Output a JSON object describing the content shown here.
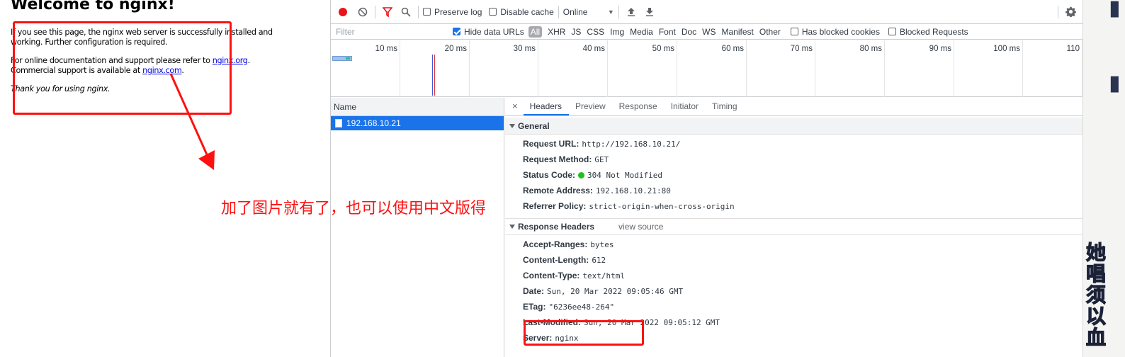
{
  "nginx": {
    "title": "Welcome to nginx!",
    "p1_line1": "If you see this page, the nginx web server is successfully installed and",
    "p1_line2": "working. Further configuration is required.",
    "p2_line1_prefix": "For online documentation and support please refer to ",
    "p2_link1": "nginx.org",
    "p2_line1_suffix": ".",
    "p2_line2_prefix": "Commercial support is available at ",
    "p2_link2": "nginx.com",
    "p2_line2_suffix": ".",
    "p3": "Thank you for using nginx."
  },
  "toolbar": {
    "record_icon": "record-icon",
    "clear_icon": "clear-icon",
    "filter_icon": "filter-icon",
    "search_icon": "search-icon",
    "preserve_log": {
      "label": "Preserve log",
      "checked": false
    },
    "disable_cache": {
      "label": "Disable cache",
      "checked": false
    },
    "throttling": "Online",
    "upload_icon": "import-har-icon",
    "download_icon": "export-har-icon",
    "settings_icon": "gear-icon"
  },
  "filterbar": {
    "placeholder": "Filter",
    "hide_data_urls": {
      "label": "Hide data URLs",
      "checked": true
    },
    "types": [
      "All",
      "XHR",
      "JS",
      "CSS",
      "Img",
      "Media",
      "Font",
      "Doc",
      "WS",
      "Manifest",
      "Other"
    ],
    "active_type": "All",
    "has_blocked_cookies": {
      "label": "Has blocked cookies",
      "checked": false
    },
    "blocked_requests": {
      "label": "Blocked Requests",
      "checked": false
    }
  },
  "overview": {
    "ticks": [
      "10 ms",
      "20 ms",
      "30 ms",
      "40 ms",
      "50 ms",
      "60 ms",
      "70 ms",
      "80 ms",
      "90 ms",
      "100 ms",
      "110"
    ]
  },
  "requests": {
    "header": "Name",
    "items": [
      {
        "name": "192.168.10.21",
        "selected": true
      }
    ]
  },
  "details": {
    "close": "×",
    "tabs": [
      "Headers",
      "Preview",
      "Response",
      "Initiator",
      "Timing"
    ],
    "active_tab": "Headers",
    "general": {
      "title": "General",
      "rows": [
        {
          "key": "Request URL:",
          "value": "http://192.168.10.21/"
        },
        {
          "key": "Request Method:",
          "value": "GET"
        },
        {
          "key": "Status Code:",
          "value": "304 Not Modified"
        },
        {
          "key": "Remote Address:",
          "value": "192.168.10.21:80"
        },
        {
          "key": "Referrer Policy:",
          "value": "strict-origin-when-cross-origin"
        }
      ]
    },
    "response_headers": {
      "title": "Response Headers",
      "view_source": "view source",
      "rows": [
        {
          "key": "Accept-Ranges:",
          "value": "bytes"
        },
        {
          "key": "Content-Length:",
          "value": "612"
        },
        {
          "key": "Content-Type:",
          "value": "text/html"
        },
        {
          "key": "Date:",
          "value": "Sun, 20 Mar 2022 09:05:46 GMT"
        },
        {
          "key": "ETag:",
          "value": "\"6236ee48-264\""
        },
        {
          "key": "Last-Modified:",
          "value": "Sun, 20 Mar 2022 09:05:12 GMT"
        },
        {
          "key": "Server:",
          "value": "nginx"
        }
      ]
    }
  },
  "annotation": {
    "text": "加了图片就有了，也可以使用中文版得",
    "color": "#ff1010"
  },
  "right_strip": {
    "text": "她唱须以血"
  },
  "colors": {
    "accent": "#1a73e8",
    "status_ok": "#20c020",
    "record": "#e8141a"
  }
}
